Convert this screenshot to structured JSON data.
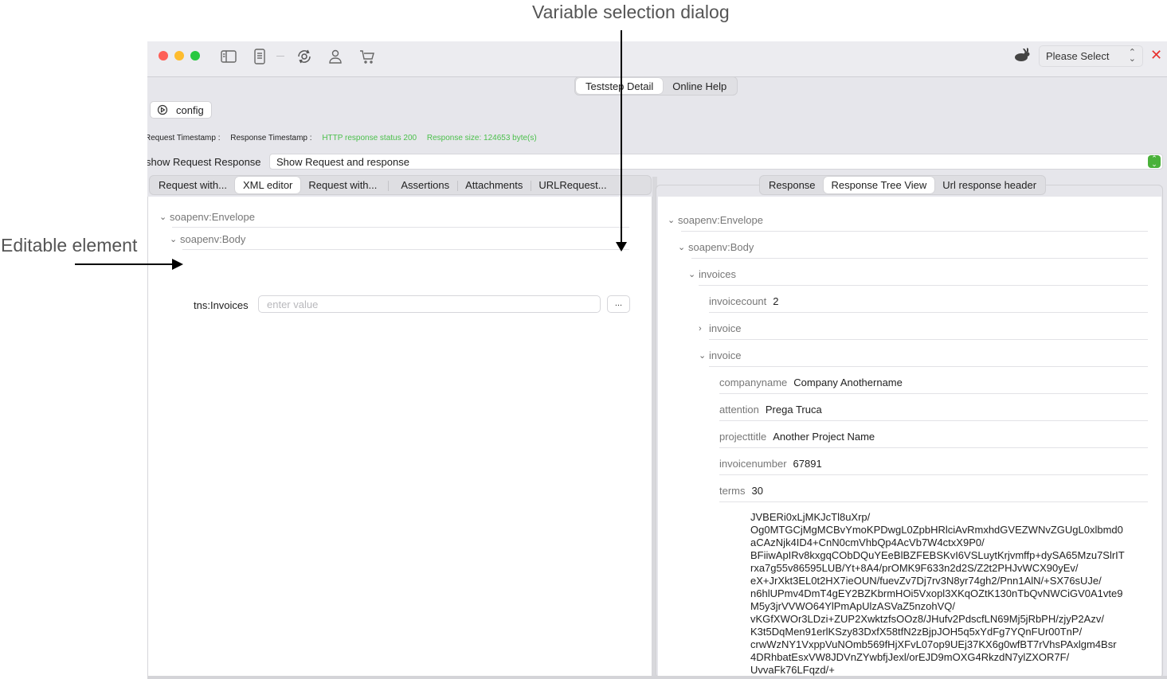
{
  "annotations": {
    "top": "Variable selection dialog",
    "left": "Editable element"
  },
  "titlebar": {
    "icons": [
      "sidebar-icon",
      "list-icon",
      "sync-gear-icon",
      "user-icon",
      "cart-icon"
    ],
    "environment_select": "Please Select",
    "close_glyph": "✕"
  },
  "top_tabs": [
    {
      "label": "Teststep Detail",
      "active": true
    },
    {
      "label": "Online Help",
      "active": false
    }
  ],
  "config": {
    "label": "config"
  },
  "status": {
    "request_timestamp_label": "Request Timestamp :",
    "response_timestamp_label": "Response Timestamp :",
    "http_status": "HTTP response status 200",
    "response_size": "Response size: 124653  byte(s)",
    "status_color": "#4cc04c"
  },
  "show_request_response": {
    "label": "show Request Response",
    "value": "Show Request and response"
  },
  "left_tabs": [
    {
      "label": "Request with...",
      "active": false
    },
    {
      "label": "XML editor",
      "active": true
    },
    {
      "label": "Request with...",
      "active": false
    },
    {
      "label": "Assertions",
      "active": false
    },
    {
      "label": "Attachments",
      "active": false
    },
    {
      "label": "URLRequest...",
      "active": false
    }
  ],
  "xml_editor": {
    "nodes": [
      {
        "label": "soapenv:Envelope",
        "expanded": true
      },
      {
        "label": "soapenv:Body",
        "expanded": true
      }
    ],
    "editable": {
      "label": "tns:Invoices",
      "value": "",
      "placeholder": "enter value",
      "variable_button": "..."
    }
  },
  "right_tabs": [
    {
      "label": "Response",
      "active": false
    },
    {
      "label": "Response Tree View",
      "active": true
    },
    {
      "label": "Url response header",
      "active": false
    }
  ],
  "response_tree": {
    "envelope": "soapenv:Envelope",
    "body": "soapenv:Body",
    "invoices": "invoices",
    "invoicecount": {
      "key": "invoicecount",
      "value": "2"
    },
    "invoice_collapsed": "invoice",
    "invoice_expanded": "invoice",
    "fields": [
      {
        "key": "companyname",
        "value": "Company Anothername"
      },
      {
        "key": "attention",
        "value": "Prega Truca"
      },
      {
        "key": "projecttitle",
        "value": "Another Project Name"
      },
      {
        "key": "invoicenumber",
        "value": "67891"
      },
      {
        "key": "terms",
        "value": "30"
      }
    ],
    "base64_lines": [
      "JVBERi0xLjMKJcTl8uXrp/",
      "Og0MTGCjMgMCBvYmoKPDwgL0ZpbHRlciAvRmxhdGVEZWNvZGUgL0xlbmd0",
      "aCAzNjk4ID4+CnN0cmVhbQp4AcVb7W4ctxX9P0/",
      "BFiiwApIRv8kxgqCObDQuYEeBlBZFEBSKvI6VSLuytKrjvmffp+dySA65Mzu7SlrIT",
      "rxa7g55v86595LUB/Yt+8A4/prOMK9F633n2d2S/Z2t2PHJvWCX90yEv/",
      "eX+JrXkt3EL0t2HX7ieOUN/fuevZv7Dj7rv3N8yr74gh2/Pnn1AlN/+SX76sUJe/",
      "n6hlUPmv4DmT4gEY2BZKbrmHOi5Vxopl3XKqOZtK130nTbQvNWCiGV0A1vte9",
      "M5y3jrVVWO64YlPmApUlzASVaZ5nzohVQ/",
      "vKGfXWOr3LDzi+ZUP2XwktzfsOOz8/JHufv2PdscfLN69Mj5jRbPH/zjyP2Azv/",
      "K3t5DqMen91erlKSzy83DxfX58tfN2zBjpJOH5q5xYdFg7YQnFUr00TnP/",
      "crwWzNY1VxppVuNOmb569fHjXFvL07op9UEj37KX6g0wfBT7rVhsPAxlgm4Bsr",
      "4DRhbatEsxVW8JDVnZYwbfjJexl/orEJD9mOXG4RkzdN7ylZXOR7F/",
      "UvvaFk76LFqzd/+"
    ]
  }
}
